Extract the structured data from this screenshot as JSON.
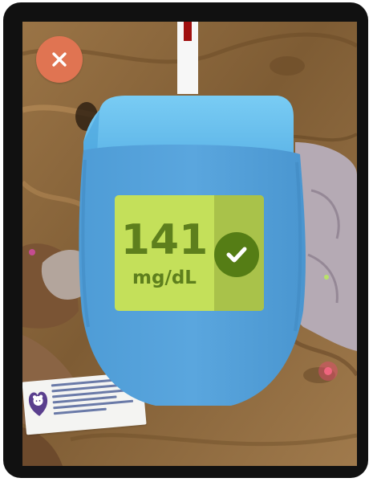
{
  "reading": {
    "value": "141",
    "unit": "mg/dL",
    "status": "in-range"
  },
  "icons": {
    "close": "close-icon",
    "check": "check-icon"
  },
  "colors": {
    "close_button": "#e07452",
    "meter_body": "#5aa6de",
    "meter_top": "#6fc4ef",
    "display_bg": "#c4e05a",
    "display_side": "#a9c24a",
    "reading_text": "#5e7f1d",
    "check_badge": "#557d15"
  }
}
